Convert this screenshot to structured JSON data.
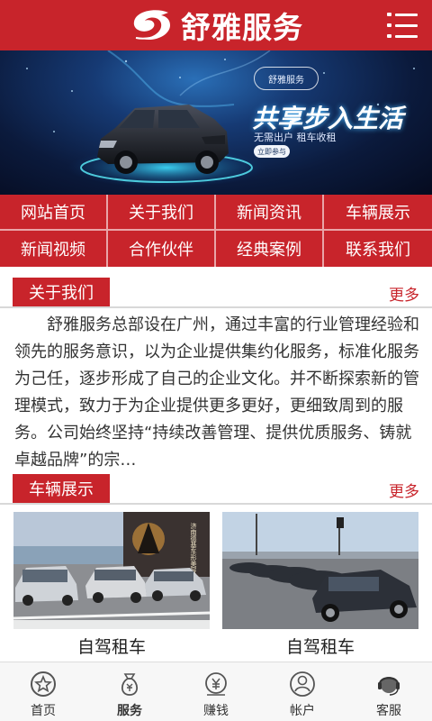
{
  "header": {
    "title": "舒雅服务",
    "logo_icon": "swirl-logo-icon",
    "menu_icon": "menu-list-icon",
    "brand_color": "#c8242b"
  },
  "banner": {
    "brand_tag": "舒雅服务",
    "slogan": "共享步入生活",
    "subtitle": "无需出户 租车收租",
    "cta": "立即参与"
  },
  "nav": {
    "items": [
      "网站首页",
      "关于我们",
      "新闻资讯",
      "车辆展示",
      "新闻视频",
      "合作伙伴",
      "经典案例",
      "联系我们"
    ]
  },
  "about": {
    "title": "关于我们",
    "more": "更多",
    "text": "舒雅服务总部设在广州，通过丰富的行业管理经验和领先的服务意识，以为企业提供集约化服务，标准化服务为己任，逐步形成了自己的企业文化。并不断探索新的管理模式，致力于为企业提供更多更好，更细致周到的服务。公司始终坚持“持续改善管理、提供优质服务、铸就卓越品牌”的宗…"
  },
  "vehicles": {
    "title": "车辆展示",
    "more": "更多",
    "items": [
      {
        "caption": "自驾租车",
        "sign_text": "济南德基车形美容医院"
      },
      {
        "caption": "自驾租车"
      }
    ]
  },
  "tabbar": {
    "items": [
      {
        "label": "首页",
        "icon": "star-circle-icon"
      },
      {
        "label": "服务",
        "icon": "money-bag-icon"
      },
      {
        "label": "赚钱",
        "icon": "yen-coin-icon"
      },
      {
        "label": "帐户",
        "icon": "user-circle-icon"
      },
      {
        "label": "客服",
        "icon": "headset-icon"
      }
    ]
  }
}
